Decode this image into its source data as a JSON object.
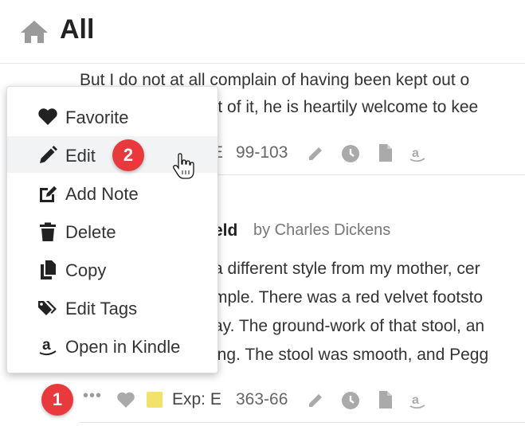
{
  "header": {
    "title": "All",
    "home_icon": "home-icon"
  },
  "passage1": {
    "lines": [
      "But I do not at all complain of having been kept out o",
      "ent of it, he is heartily welcome to kee"
    ],
    "meta": {
      "partial": "E",
      "range": "99-103"
    }
  },
  "book": {
    "title_partial": "eld",
    "author": "by Charles Dickens"
  },
  "passage2": {
    "lines": [
      "a different style from my mother, cer",
      "mple. There was a red velvet footsto",
      "ay. The ground-work of that stool, an",
      "ing. The stool was smooth, and Pegg"
    ],
    "meta": {
      "dots": "•••",
      "exp": "Exp: E",
      "range": "363-66",
      "highlight_color": "#f0e26a"
    }
  },
  "menu": {
    "items": [
      {
        "label": "Favorite",
        "icon": "heart-icon"
      },
      {
        "label": "Edit",
        "icon": "pencil-icon"
      },
      {
        "label": "Add Note",
        "icon": "edit-note-icon"
      },
      {
        "label": "Delete",
        "icon": "trash-icon"
      },
      {
        "label": "Copy",
        "icon": "copy-icon"
      },
      {
        "label": "Edit Tags",
        "icon": "tags-icon"
      },
      {
        "label": "Open in Kindle",
        "icon": "amazon-icon"
      }
    ]
  },
  "badges": {
    "one": "1",
    "two": "2"
  },
  "colors": {
    "badge": "#e8393c",
    "icon_gray": "#aaaaaa",
    "menu_icon": "#222222"
  }
}
